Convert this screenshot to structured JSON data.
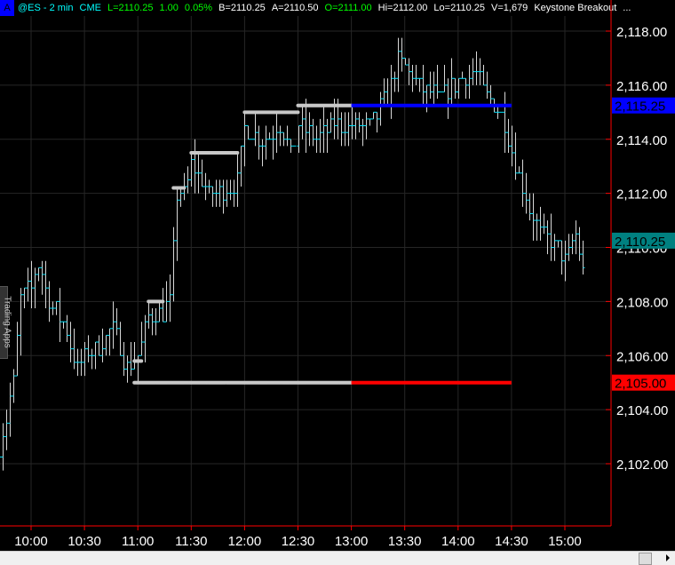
{
  "header": {
    "badge": "A",
    "symbol": "@ES - 2 min",
    "exchange": "CME",
    "last": "L=2110.25",
    "change": "1.00",
    "change_pct": "0.05%",
    "bid": "B=2110.25",
    "ask": "A=2110.50",
    "open": "O=2111.00",
    "high": "Hi=2112.00",
    "low": "Lo=2110.25",
    "volume": "V=1,679",
    "study": "Keystone Breakout",
    "more": "..."
  },
  "side_tab": "Trading Apps",
  "colors": {
    "bar": "#d8d8d8",
    "tick": "#00e5ff",
    "up": "#00ff00",
    "blue": "#0000ff",
    "red": "#ff0000",
    "teal": "#008080",
    "dots": "#c8c8c8"
  },
  "chart_data": {
    "type": "ohlc",
    "interval": "2 min",
    "ylim": [
      2101,
      2119
    ],
    "y_ticks": [
      "2,102.00",
      "2,104.00",
      "2,106.00",
      "2,108.00",
      "2,110.00",
      "2,112.00",
      "2,114.00",
      "2,116.00",
      "2,118.00"
    ],
    "x_ticks": [
      "10:00",
      "10:30",
      "11:00",
      "11:30",
      "12:00",
      "12:30",
      "13:00",
      "13:30",
      "14:00",
      "14:30",
      "15:00"
    ],
    "close_path": [
      [
        "9:42",
        2102.5
      ],
      [
        "9:50",
        2105
      ],
      [
        "9:54",
        2108
      ],
      [
        "10:00",
        2108.5
      ],
      [
        "10:04",
        2109.5
      ],
      [
        "10:10",
        2108
      ],
      [
        "10:20",
        2107
      ],
      [
        "10:26",
        2105.5
      ],
      [
        "10:30",
        2106
      ],
      [
        "10:40",
        2106.5
      ],
      [
        "10:46",
        2107
      ],
      [
        "10:54",
        2105.5
      ],
      [
        "11:00",
        2106
      ],
      [
        "11:06",
        2107.5
      ],
      [
        "11:14",
        2107.5
      ],
      [
        "11:18",
        2108
      ],
      [
        "11:22",
        2112
      ],
      [
        "11:26",
        2112
      ],
      [
        "11:30",
        2113
      ],
      [
        "11:40",
        2112
      ],
      [
        "11:50",
        2112.2
      ],
      [
        "11:56",
        2112.5
      ],
      [
        "12:00",
        2114.5
      ],
      [
        "12:10",
        2114
      ],
      [
        "12:20",
        2114.5
      ],
      [
        "12:26",
        2113.5
      ],
      [
        "12:30",
        2114.5
      ],
      [
        "12:40",
        2114
      ],
      [
        "12:50",
        2114.5
      ],
      [
        "13:00",
        2114.5
      ],
      [
        "13:10",
        2114.5
      ],
      [
        "13:20",
        2115.5
      ],
      [
        "13:26",
        2117
      ],
      [
        "13:32",
        2116.5
      ],
      [
        "13:40",
        2115.8
      ],
      [
        "13:50",
        2115.5
      ],
      [
        "14:00",
        2116.2
      ],
      [
        "14:10",
        2116.5
      ],
      [
        "14:16",
        2115.5
      ],
      [
        "14:24",
        2115
      ],
      [
        "14:30",
        2113.5
      ],
      [
        "14:40",
        2111.5
      ],
      [
        "14:46",
        2110.5
      ],
      [
        "14:56",
        2110
      ],
      [
        "15:00",
        2109.5
      ],
      [
        "15:06",
        2110.5
      ],
      [
        "15:10",
        2109.2
      ]
    ],
    "breakout_dots": [
      [
        "10:58",
        "11:02",
        2105.8
      ],
      [
        "11:06",
        "11:14",
        2108
      ],
      [
        "11:20",
        "11:26",
        2112.2
      ],
      [
        "11:30",
        "11:56",
        2113.5
      ],
      [
        "12:00",
        "12:30",
        2115
      ],
      [
        "12:30",
        "13:00",
        2115.25
      ],
      [
        "10:58",
        "13:00",
        2105
      ]
    ],
    "levels": [
      {
        "price": 2115.25,
        "label": "2,115.25",
        "color": "#0000ff",
        "from": "13:00",
        "to": "14:30"
      },
      {
        "price": 2105,
        "label": "2,105.00",
        "color": "#ff0000",
        "from": "13:00",
        "to": "14:30"
      }
    ],
    "last_price": {
      "price": 2110.25,
      "label": "2,110.25",
      "color": "#008080"
    }
  }
}
